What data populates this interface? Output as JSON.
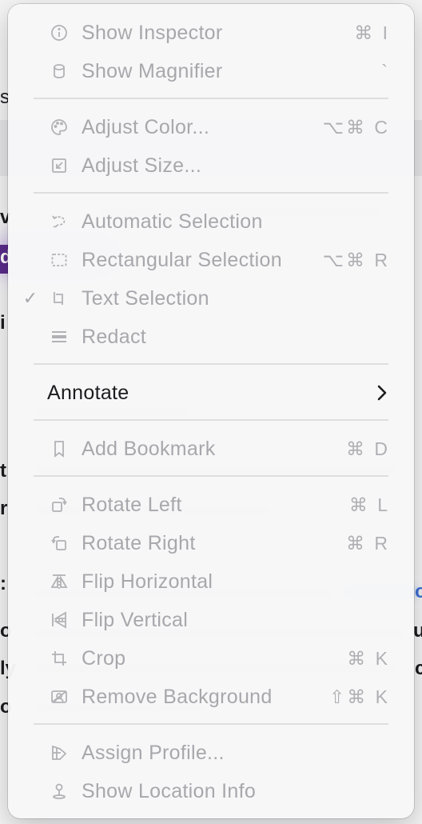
{
  "background": {
    "fragments": [
      "s",
      "v",
      "d",
      "i",
      "t",
      "r",
      ":",
      "o",
      "u",
      "ly",
      "o",
      "c",
      "o"
    ]
  },
  "menu": {
    "items": [
      {
        "label": "Show Inspector",
        "shortcut": "⌘ I",
        "icon": "info-icon"
      },
      {
        "label": "Show Magnifier",
        "shortcut": "`",
        "icon": "magnifier-icon"
      },
      {
        "label": "Adjust Color...",
        "shortcut": "⌥⌘ C",
        "icon": "palette-icon"
      },
      {
        "label": "Adjust Size...",
        "shortcut": "",
        "icon": "resize-icon"
      },
      {
        "label": "Automatic Selection",
        "shortcut": "",
        "icon": "lasso-icon"
      },
      {
        "label": "Rectangular Selection",
        "shortcut": "⌥⌘ R",
        "icon": "rect-selection-icon"
      },
      {
        "label": "Text Selection",
        "shortcut": "",
        "icon": "text-selection-icon",
        "checked": true,
        "checkmark": "✓"
      },
      {
        "label": "Redact",
        "shortcut": "",
        "icon": "redact-icon"
      },
      {
        "label": "Annotate",
        "shortcut": "",
        "icon": "",
        "submenu": true
      },
      {
        "label": "Add Bookmark",
        "shortcut": "⌘ D",
        "icon": "bookmark-icon"
      },
      {
        "label": "Rotate Left",
        "shortcut": "⌘ L",
        "icon": "rotate-left-icon"
      },
      {
        "label": "Rotate Right",
        "shortcut": "⌘ R",
        "icon": "rotate-right-icon"
      },
      {
        "label": "Flip Horizontal",
        "shortcut": "",
        "icon": "flip-horizontal-icon"
      },
      {
        "label": "Flip Vertical",
        "shortcut": "",
        "icon": "flip-vertical-icon"
      },
      {
        "label": "Crop",
        "shortcut": "⌘ K",
        "icon": "crop-icon"
      },
      {
        "label": "Remove Background",
        "shortcut": "⇧⌘ K",
        "icon": "remove-background-icon"
      },
      {
        "label": "Assign Profile...",
        "shortcut": "",
        "icon": "profile-icon"
      },
      {
        "label": "Show Location Info",
        "shortcut": "",
        "icon": "location-pin-icon"
      }
    ]
  },
  "colors": {
    "menu_background": "#f7f7f8",
    "enabled_text": "#1c1c1e",
    "disabled_text": "#a8a8ac",
    "separator": "#dededf"
  }
}
